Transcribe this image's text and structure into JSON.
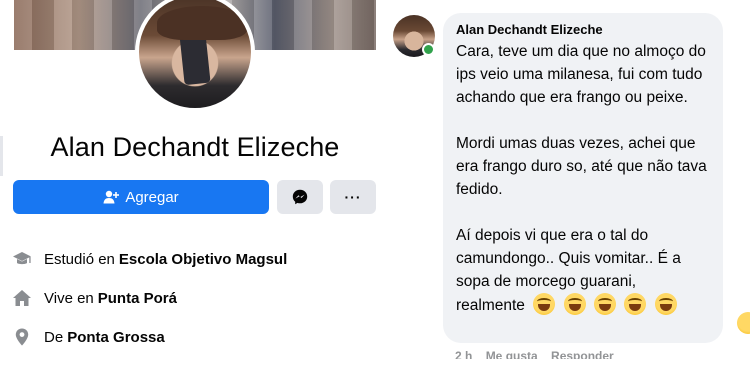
{
  "profile": {
    "name": "Alan Dechandt Elizeche",
    "add_button_label": "Agregar",
    "more_button_label": "···",
    "info": [
      {
        "icon": "graduation-cap-icon",
        "prefix": "Estudió en",
        "bold": "Escola Objetivo Magsul"
      },
      {
        "icon": "home-icon",
        "prefix": "Vive en",
        "bold": "Punta Porá"
      },
      {
        "icon": "location-pin-icon",
        "prefix": "De",
        "bold": "Ponta Grossa"
      }
    ]
  },
  "comment": {
    "author": "Alan Dechandt Elizeche",
    "paragraphs": [
      "Cara, teve um dia que no almoço do ips veio uma milanesa, fui com tudo achando que era frango ou peixe.",
      "Mordi umas duas vezes, achei que era frango duro so, até que não tava fedido.",
      "Aí depois vi que era o tal do camundongo.. Quis vomitar.. É a sopa de morcego guarani,"
    ],
    "last_line": "realmente",
    "trailing_emojis": [
      "laughing-tears-emoji",
      "laughing-tears-emoji",
      "laughing-tears-emoji",
      "laughing-tears-emoji",
      "laughing-tears-emoji"
    ],
    "actions": [
      "2 h",
      "Me gusta",
      "Responder"
    ]
  },
  "colors": {
    "primary_button": "#1877f2",
    "secondary_button": "#e4e6eb",
    "bubble_background": "#f0f2f5",
    "online_indicator": "#31a24c"
  }
}
